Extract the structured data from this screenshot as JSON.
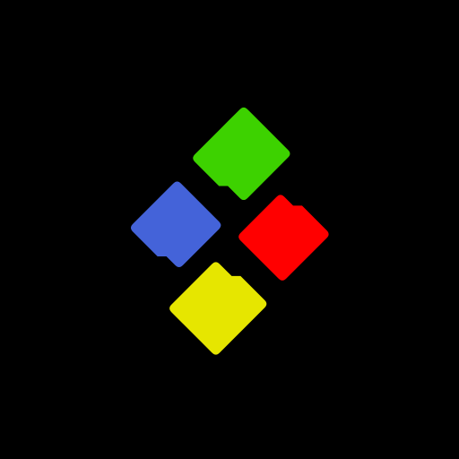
{
  "canvas": {
    "background": "#000000"
  },
  "logo": {
    "icon": "four-color-folder-diamond-icon",
    "tiles": [
      {
        "name": "green-folder-tile",
        "color": "#3DD200"
      },
      {
        "name": "red-folder-tile",
        "color": "#FF0000"
      },
      {
        "name": "yellow-folder-tile",
        "color": "#E6E600"
      },
      {
        "name": "blue-folder-tile",
        "color": "#4463D9"
      }
    ]
  }
}
